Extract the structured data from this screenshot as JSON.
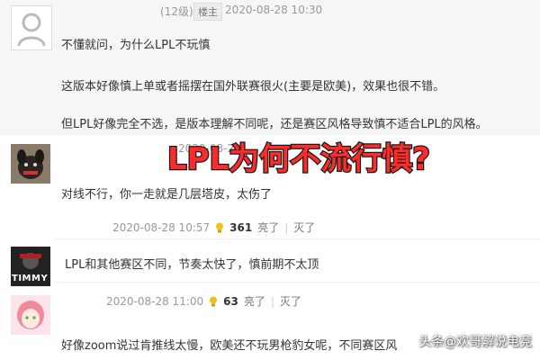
{
  "post": {
    "level": "(12级)",
    "floor_badge": "楼主",
    "timestamp": "2020-08-28 10:30",
    "title_line": "不懂就问，为什么LPL不玩慎",
    "para1": "这版本好像慎上单或者摇摆在国外联赛很火(主要是欧美)，效果也很不错。",
    "para2": "但LPL好像完全不选，是版本理解不同呢，还是赛区风格导致慎不适合LPL的风格。"
  },
  "banner": {
    "text": "LPL为何不流行慎?"
  },
  "replies": [
    {
      "partial_meta": "2020-08-28",
      "text": "对线不行，你一走就是几层塔皮，太伤了",
      "timestamp": "2020-08-28 10:57",
      "likes": "361",
      "like_label": "亮了",
      "dislike_label": "灭了"
    },
    {
      "avatar_text": "TIMMY",
      "text": "LPL和其他赛区不同，节奏太快了，慎前期不太顶",
      "timestamp": "2020-08-28 11:00",
      "likes": "63",
      "like_label": "亮了",
      "dislike_label": "灭了"
    },
    {
      "text": "好像zoom说过肯推线太慢，欧美还不玩男枪豹女呢，不同赛区风"
    }
  ],
  "watermark": "头条@欢哥解说电竞",
  "colors": {
    "banner_text": "#ff2a2a",
    "banner_stroke": "#1a1a1a",
    "meta": "#999999",
    "bulb": "#f3c21a"
  }
}
